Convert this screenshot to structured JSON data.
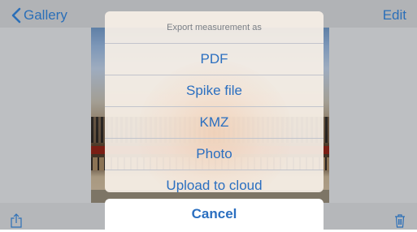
{
  "navbar": {
    "back_label": "Gallery",
    "edit_label": "Edit"
  },
  "action_sheet": {
    "title": "Export measurement as",
    "items": [
      {
        "label": "PDF"
      },
      {
        "label": "Spike file"
      },
      {
        "label": "KMZ"
      },
      {
        "label": "Photo"
      },
      {
        "label": "Upload to cloud"
      }
    ],
    "cancel_label": "Cancel"
  },
  "toolbar": {
    "share_icon": "share-icon",
    "trash_icon": "trash-icon"
  },
  "colors": {
    "accent": "#2b6fc0",
    "sheet_background": "#f6efe6",
    "dim_background": "#bdbfc2"
  }
}
